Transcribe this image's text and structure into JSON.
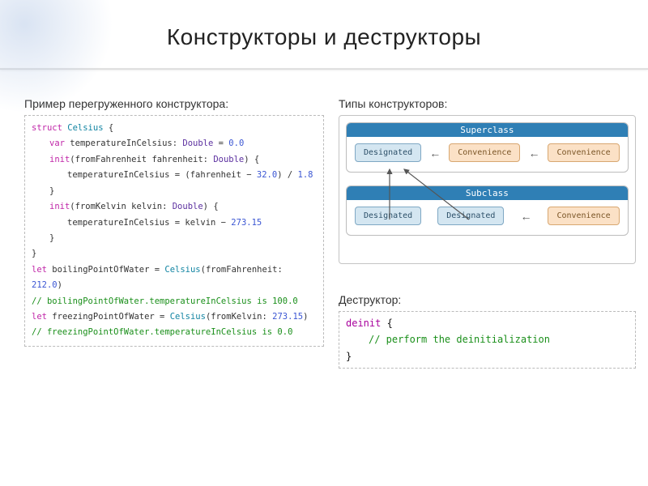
{
  "title": "Конструкторы и деструкторы",
  "leftLabel": "Пример перегруженного конструктора:",
  "rightLabel1": "Типы конструкторов:",
  "rightLabel2": "Деструктор:",
  "code": {
    "l1_kw": "struct",
    "l1_name": "Celsius",
    "l1_tail": " {",
    "l2_kw": "var",
    "l2_name": "temperatureInCelsius",
    "l2_colon": ": ",
    "l2_type": "Double",
    "l2_eq": " = ",
    "l2_val": "0.0",
    "l3_kw": "init",
    "l3_open": "(fromFahrenheit fahrenheit: ",
    "l3_type": "Double",
    "l3_close": ") {",
    "l4_lhs": "temperatureInCelsius",
    "l4_eq": " = (fahrenheit − ",
    "l4_v1": "32.0",
    "l4_mid": ") / ",
    "l4_v2": "1.8",
    "l5": "}",
    "l6_kw": "init",
    "l6_open": "(fromKelvin kelvin: ",
    "l6_type": "Double",
    "l6_close": ") {",
    "l7_lhs": "temperatureInCelsius",
    "l7_eq": " = kelvin − ",
    "l7_v": "273.15",
    "l8": "}",
    "l9": "}",
    "l10_kw": "let",
    "l10_name": "boilingPointOfWater",
    "l10_eq": " = ",
    "l10_type": "Celsius",
    "l10_args": "(fromFahrenheit: ",
    "l10_v": "212.0",
    "l10_close": ")",
    "l11": "// boilingPointOfWater.temperatureInCelsius is 100.0",
    "l12_kw": "let",
    "l12_name": "freezingPointOfWater",
    "l12_eq": " = ",
    "l12_type": "Celsius",
    "l12_args": "(fromKelvin: ",
    "l12_v": "273.15",
    "l12_close": ")",
    "l13": "// freezingPointOfWater.temperatureInCelsius is 0.0"
  },
  "diagram": {
    "super": {
      "title": "Superclass",
      "nodes": [
        "Designated",
        "Convenience",
        "Convenience"
      ]
    },
    "sub": {
      "title": "Subclass",
      "nodes": [
        "Designated",
        "Designated",
        "Convenience"
      ]
    }
  },
  "deinit": {
    "l1_kw": "deinit",
    "l1_tail": " {",
    "l2": "// perform the deinitialization",
    "l3": "}"
  }
}
